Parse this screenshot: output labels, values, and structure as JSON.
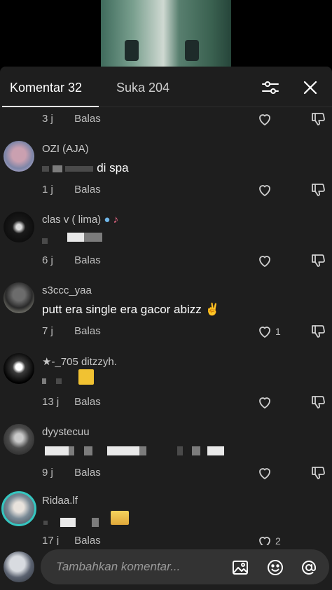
{
  "tabs": {
    "comments": "Komentar 32",
    "likes": "Suka 204"
  },
  "reply_label": "Balas",
  "top_row": {
    "time": "3 j"
  },
  "comments": [
    {
      "username": "OZI (AJA)",
      "text": "di spa",
      "time": "1 j",
      "likes": ""
    },
    {
      "username": "clas v ( lima)",
      "text": "",
      "time": "6 j",
      "likes": ""
    },
    {
      "username": "s3ccc_yaa",
      "text": "putt era single era gacor abizz",
      "time": "7 j",
      "likes": "1"
    },
    {
      "username": "★-_705 ditzzyh.",
      "text": "",
      "time": "13 j",
      "likes": ""
    },
    {
      "username": "dyystecuu",
      "text": "",
      "time": "9 j",
      "likes": ""
    },
    {
      "username": "Ridaa.lf",
      "text": "",
      "time": "17 j",
      "likes": "2"
    }
  ],
  "input": {
    "placeholder": "Tambahkan komentar..."
  },
  "icons": {
    "filter": "sliders-icon",
    "close": "close-icon",
    "heart": "heart-icon",
    "dislike": "thumbs-down-icon",
    "image": "image-icon",
    "emoji": "emoji-icon",
    "mention": "at-icon"
  }
}
